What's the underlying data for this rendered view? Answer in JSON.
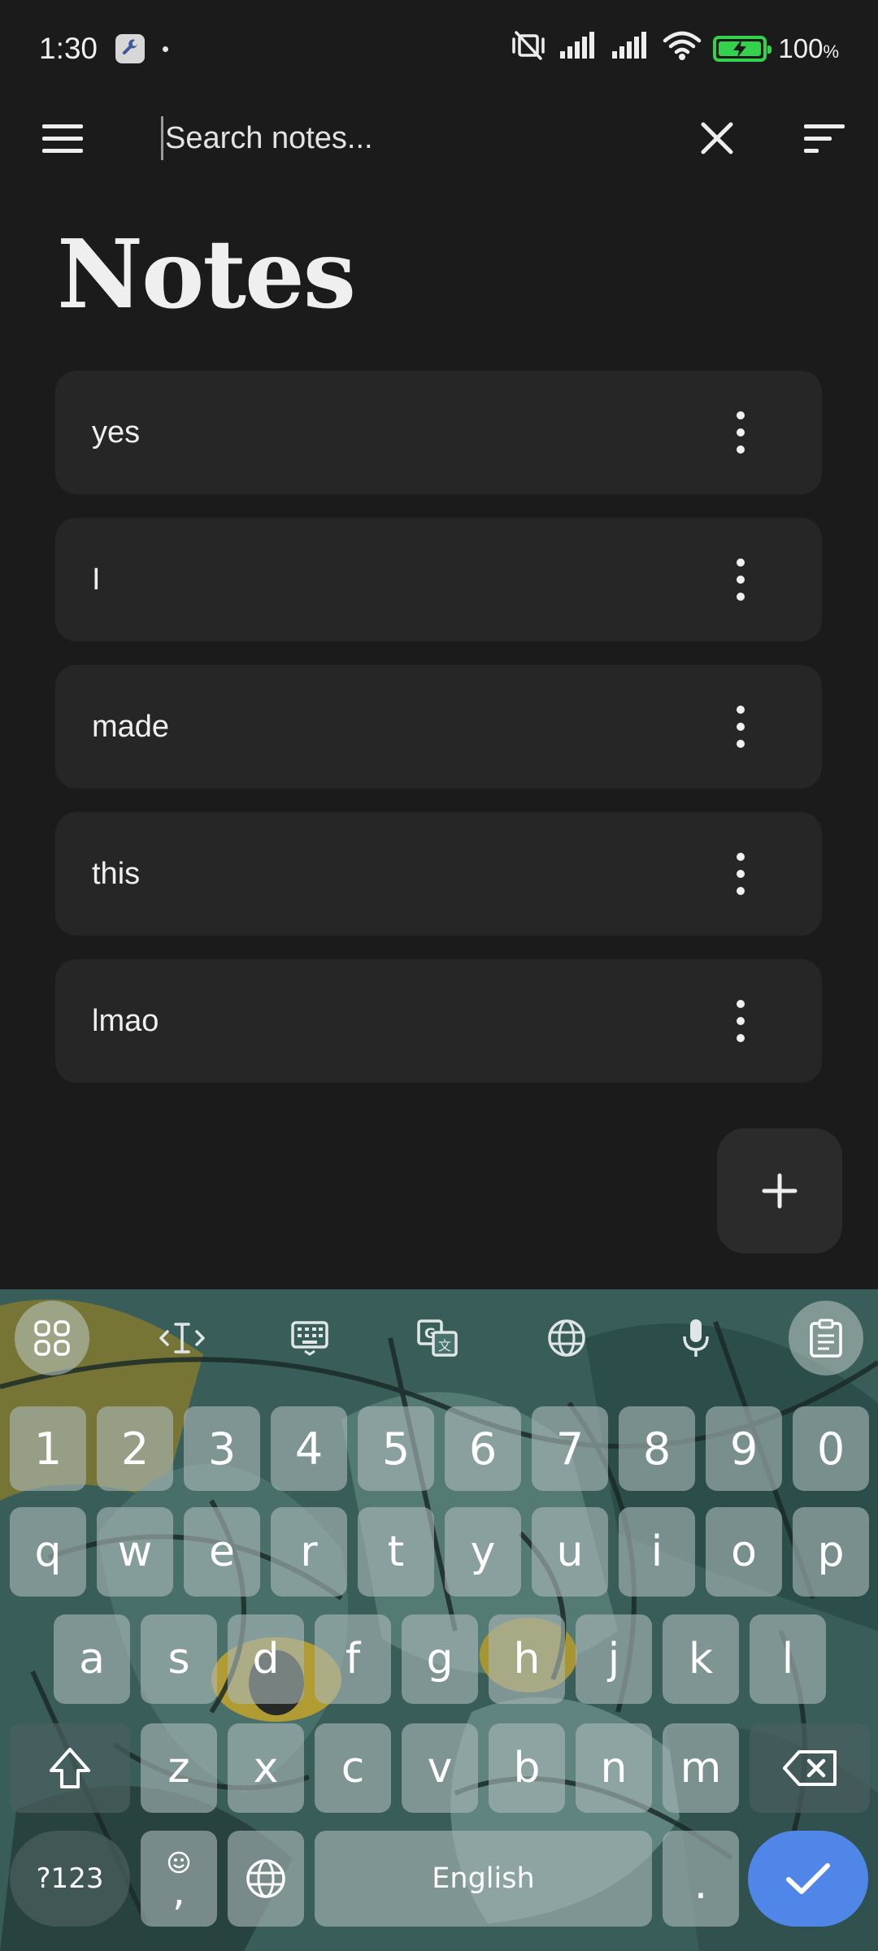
{
  "status_bar": {
    "time": "1:30",
    "battery_percent": "100",
    "battery_unit": "%",
    "icons": [
      "wrench-icon",
      "notification-dot",
      "vibrate-off-icon",
      "signal-icon",
      "signal-icon",
      "wifi-icon",
      "battery-charging-icon"
    ]
  },
  "app_bar": {
    "search_placeholder": "Search notes...",
    "search_value": ""
  },
  "page": {
    "title": "Notes"
  },
  "notes": [
    {
      "title": "yes"
    },
    {
      "title": "I"
    },
    {
      "title": "made"
    },
    {
      "title": "this"
    },
    {
      "title": "lmao"
    }
  ],
  "keyboard": {
    "number_row": [
      "1",
      "2",
      "3",
      "4",
      "5",
      "6",
      "7",
      "8",
      "9",
      "0"
    ],
    "row1": [
      "q",
      "w",
      "e",
      "r",
      "t",
      "y",
      "u",
      "i",
      "o",
      "p"
    ],
    "row2": [
      "a",
      "s",
      "d",
      "f",
      "g",
      "h",
      "j",
      "k",
      "l"
    ],
    "row3": [
      "z",
      "x",
      "c",
      "v",
      "b",
      "n",
      "m"
    ],
    "symbols_label": "?123",
    "comma_label": ",",
    "space_label": "English",
    "period_label": ".",
    "accent_color": "#4f86e8"
  },
  "colors": {
    "background": "#1b1b1b",
    "card": "#262626",
    "fab": "#2b2b2b",
    "battery": "#34d14c"
  }
}
